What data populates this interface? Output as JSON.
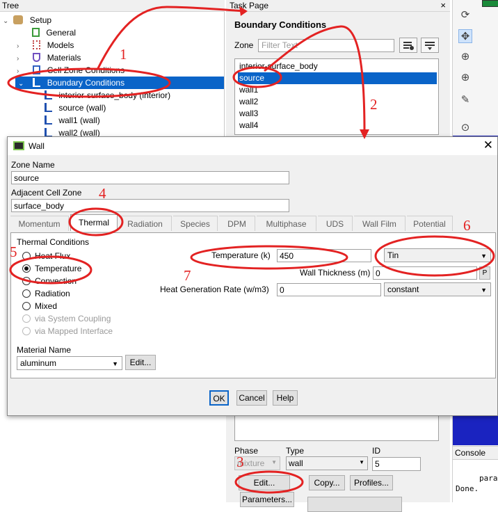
{
  "tree": {
    "header": "Tree",
    "items": [
      {
        "label": "Setup",
        "icon": "setup-icon"
      },
      {
        "label": "General",
        "icon": "general-icon"
      },
      {
        "label": "Models",
        "icon": "models-icon"
      },
      {
        "label": "Materials",
        "icon": "materials-icon"
      },
      {
        "label": "Cell Zone Conditions",
        "icon": "cell-zone-icon"
      },
      {
        "label": "Boundary Conditions",
        "icon": "boundary-icon"
      },
      {
        "label": "interior-surface_body (interior)",
        "icon": "boundary-item-icon"
      },
      {
        "label": "source (wall)",
        "icon": "boundary-item-icon"
      },
      {
        "label": "wall1 (wall)",
        "icon": "boundary-item-icon"
      },
      {
        "label": "wall2 (wall)",
        "icon": "boundary-item-icon"
      }
    ]
  },
  "task_page": {
    "header": "Task Page",
    "close": "×",
    "title": "Boundary Conditions",
    "zone_label": "Zone",
    "filter_placeholder": "Filter Text",
    "zones": [
      "interior-surface_body",
      "source",
      "wall1",
      "wall2",
      "wall3",
      "wall4"
    ],
    "selected_zone": "source",
    "phase_label": "Phase",
    "phase_value": "mixture",
    "type_label": "Type",
    "type_value": "wall",
    "id_label": "ID",
    "id_value": "5",
    "edit_button": "Edit...",
    "copy_button": "Copy...",
    "profiles_button": "Profiles...",
    "parameters_button": "Parameters..."
  },
  "console": {
    "header": "Console",
    "lines": [
      "para",
      "Done."
    ]
  },
  "wall_dialog": {
    "title": "Wall",
    "zone_name_label": "Zone Name",
    "zone_name_value": "source",
    "adjacent_label": "Adjacent Cell Zone",
    "adjacent_value": "surface_body",
    "tabs": [
      "Momentum",
      "Thermal",
      "Radiation",
      "Species",
      "DPM",
      "Multiphase",
      "UDS",
      "Wall Film",
      "Potential"
    ],
    "active_tab": "Thermal",
    "thermal_conditions_label": "Thermal Conditions",
    "conditions": [
      {
        "label": "Heat Flux",
        "checked": false,
        "disabled": false
      },
      {
        "label": "Temperature",
        "checked": true,
        "disabled": false
      },
      {
        "label": "Convection",
        "checked": false,
        "disabled": false
      },
      {
        "label": "Radiation",
        "checked": false,
        "disabled": false
      },
      {
        "label": "Mixed",
        "checked": false,
        "disabled": false
      },
      {
        "label": "via System Coupling",
        "checked": false,
        "disabled": true
      },
      {
        "label": "via Mapped Interface",
        "checked": false,
        "disabled": true
      }
    ],
    "temperature_label": "Temperature (k)",
    "temperature_value": "450",
    "temperature_profile": "Tin",
    "wall_thickness_label": "Wall Thickness (m)",
    "wall_thickness_value": "0",
    "wall_thickness_p": "P",
    "heat_gen_label": "Heat Generation Rate (w/m3)",
    "heat_gen_value": "0",
    "heat_gen_profile": "constant",
    "material_label": "Material Name",
    "material_value": "aluminum",
    "material_edit": "Edit...",
    "ok": "OK",
    "cancel": "Cancel",
    "help": "Help"
  },
  "annotations": [
    "1",
    "2",
    "3",
    "4",
    "5",
    "6",
    "7"
  ],
  "colors": {
    "selection": "#0a64c8",
    "annotation": "#e32222",
    "graphics_bg": "#1a23c0"
  }
}
